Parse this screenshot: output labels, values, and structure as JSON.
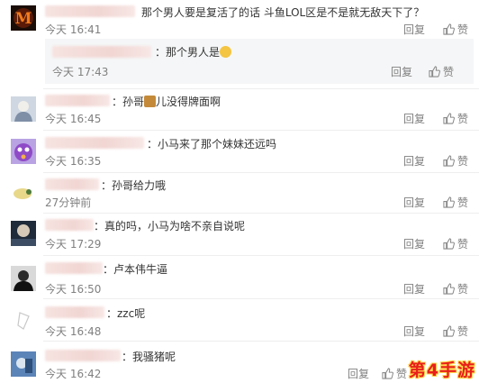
{
  "comments": [
    {
      "text": "那个男人要是复活了的话 斗鱼LOL区是不是就无敌天下了？",
      "time": "今天 16:41",
      "reply": "回复",
      "like": "赞"
    },
    {
      "text": "：孙哥",
      "text2": "儿没得牌面啊",
      "time": "今天 16:45",
      "reply": "回复",
      "like": "赞"
    },
    {
      "text": "：小马来了那个妹妹还远吗",
      "time": "今天 16:35",
      "reply": "回复",
      "like": "赞"
    },
    {
      "text": "：孙哥给力哦",
      "time": "27分钟前",
      "reply": "回复",
      "like": "赞"
    },
    {
      "text": "：真的吗，小马为啥不亲自说呢",
      "time": "今天 17:29",
      "reply": "回复",
      "like": "赞"
    },
    {
      "text": "：卢本伟牛逼",
      "time": "今天 16:50",
      "reply": "回复",
      "like": "赞"
    },
    {
      "text": "：zzc呢",
      "time": "今天 16:48",
      "reply": "回复",
      "like": "赞"
    },
    {
      "text": "：我骚猪呢",
      "time": "今天 16:42",
      "reply": "回复",
      "like": "赞"
    }
  ],
  "subreply": {
    "text": "：那个男人是",
    "time": "今天 17:43",
    "reply": "回复",
    "like": "赞"
  },
  "watermark": "第4手游",
  "colors": {
    "meta": "#808080",
    "text": "#333333",
    "subreply_bg": "#f5f6f7",
    "watermark": "#e8201b"
  }
}
